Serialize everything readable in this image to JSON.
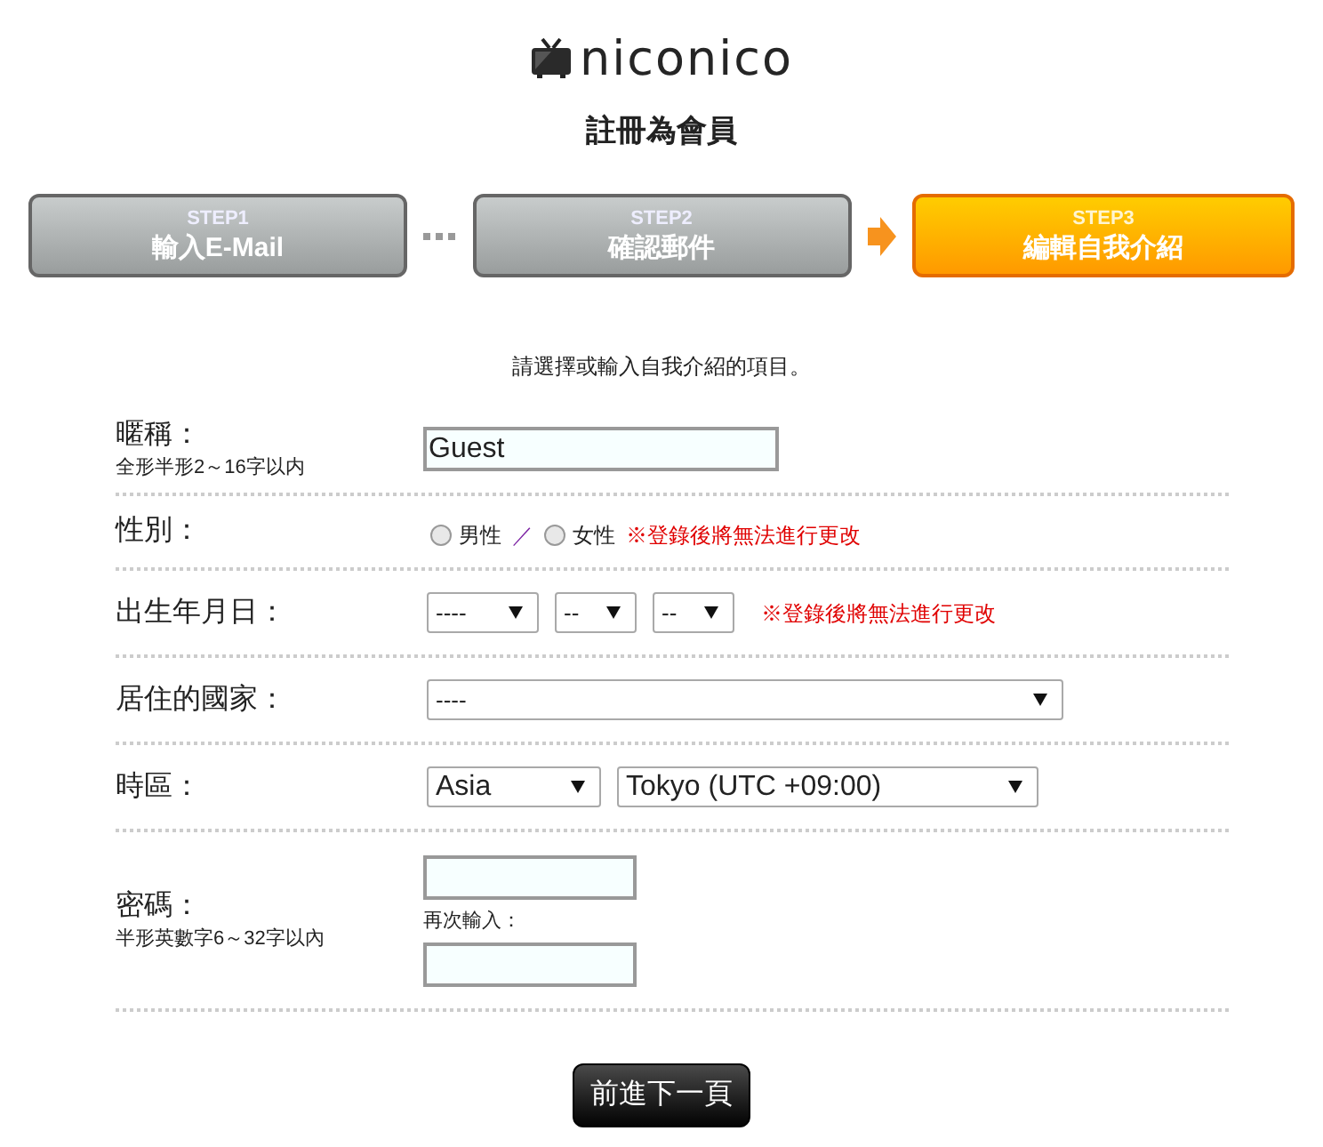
{
  "logo": {
    "text": "niconico"
  },
  "title": "註冊為會員",
  "steps": [
    {
      "step": "STEP1",
      "label": "輸入E-Mail",
      "selected": false
    },
    {
      "step": "STEP2",
      "label": "確認郵件",
      "selected": false
    },
    {
      "step": "STEP3",
      "label": "編輯自我介紹",
      "selected": true
    }
  ],
  "instruction": "請選擇或輸入自我介紹的項目。",
  "rows": [
    {
      "kind": "text",
      "label": "暱稱：",
      "hint": "全形半形2～16字以内",
      "value": "Guest"
    },
    {
      "kind": "radio",
      "label": "性別：",
      "options": [
        {
          "label": "男性",
          "selected": false
        },
        {
          "label": "女性",
          "selected": false
        }
      ],
      "separator": "／",
      "note": "※登錄後將無法進行更改"
    },
    {
      "kind": "selects",
      "label": "出生年月日：",
      "selects": [
        "----",
        "--",
        "--"
      ],
      "note": "※登錄後將無法進行更改"
    },
    {
      "kind": "selects",
      "label": "居住的國家：",
      "selects": [
        "----"
      ]
    },
    {
      "kind": "selects",
      "label": "時區：",
      "selects": [
        "Asia",
        "Tokyo (UTC +09:00)"
      ]
    },
    {
      "kind": "password",
      "label": "密碼：",
      "hint": "半形英數字6～32字以內",
      "confirm_label": "再次輸入："
    }
  ],
  "next_button": "前進下一頁"
}
